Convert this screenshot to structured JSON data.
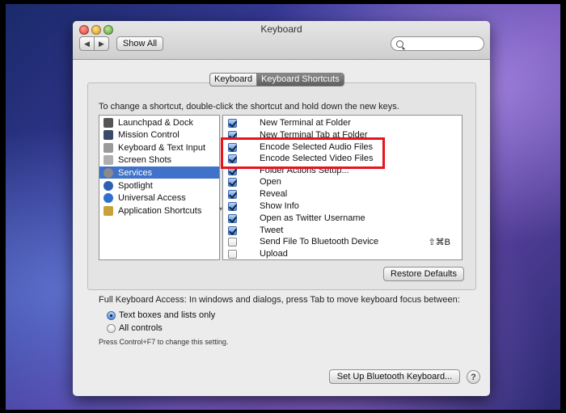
{
  "window": {
    "title": "Keyboard"
  },
  "toolbar": {
    "back_glyph": "◀",
    "forward_glyph": "▶",
    "show_all_label": "Show All",
    "search_placeholder": ""
  },
  "tabs": [
    {
      "label": "Keyboard",
      "active": false
    },
    {
      "label": "Keyboard Shortcuts",
      "active": true
    }
  ],
  "instructions": "To change a shortcut, double-click the shortcut and hold down the new keys.",
  "categories": [
    {
      "label": "Launchpad & Dock",
      "icon": "launchpad-icon",
      "color": "#555555",
      "selected": false
    },
    {
      "label": "Mission Control",
      "icon": "mission-control-icon",
      "color": "#3a4a6a",
      "selected": false
    },
    {
      "label": "Keyboard & Text Input",
      "icon": "keyboard-icon",
      "color": "#9a9a9a",
      "selected": false
    },
    {
      "label": "Screen Shots",
      "icon": "screenshot-icon",
      "color": "#b0b0b0",
      "selected": false
    },
    {
      "label": "Services",
      "icon": "gear-icon",
      "color": "#8a8a8a",
      "selected": true
    },
    {
      "label": "Spotlight",
      "icon": "spotlight-icon",
      "color": "#2f5fb5",
      "selected": false
    },
    {
      "label": "Universal Access",
      "icon": "universal-access-icon",
      "color": "#2f6fd0",
      "selected": false
    },
    {
      "label": "Application Shortcuts",
      "icon": "app-shortcuts-icon",
      "color": "#c9a13a",
      "selected": false
    }
  ],
  "shortcuts": [
    {
      "label": "New Terminal at Folder",
      "checked": true,
      "key": ""
    },
    {
      "label": "New Terminal Tab at Folder",
      "checked": true,
      "key": ""
    },
    {
      "label": "Encode Selected Audio Files",
      "checked": true,
      "key": ""
    },
    {
      "label": "Encode Selected Video Files",
      "checked": true,
      "key": ""
    },
    {
      "label": "Folder Actions Setup...",
      "checked": true,
      "key": ""
    },
    {
      "label": "Open",
      "checked": true,
      "key": ""
    },
    {
      "label": "Reveal",
      "checked": true,
      "key": ""
    },
    {
      "label": "Show Info",
      "checked": true,
      "key": ""
    },
    {
      "label": "Open as Twitter Username",
      "checked": true,
      "key": ""
    },
    {
      "label": "Tweet",
      "checked": true,
      "key": ""
    },
    {
      "label": "Send File To Bluetooth Device",
      "checked": false,
      "key": "⇧⌘B"
    },
    {
      "label": "Upload",
      "checked": false,
      "key": ""
    }
  ],
  "restore_defaults_label": "Restore Defaults",
  "full_keyboard_access": {
    "label": "Full Keyboard Access: In windows and dialogs, press Tab to move keyboard focus between:",
    "options": [
      {
        "label": "Text boxes and lists only",
        "selected": true
      },
      {
        "label": "All controls",
        "selected": false
      }
    ],
    "hint": "Press Control+F7 to change this setting."
  },
  "bluetooth_button_label": "Set Up Bluetooth Keyboard...",
  "help_label": "?",
  "colors": {
    "selection": "#3f72c8",
    "highlight_box": "#e8131b"
  }
}
